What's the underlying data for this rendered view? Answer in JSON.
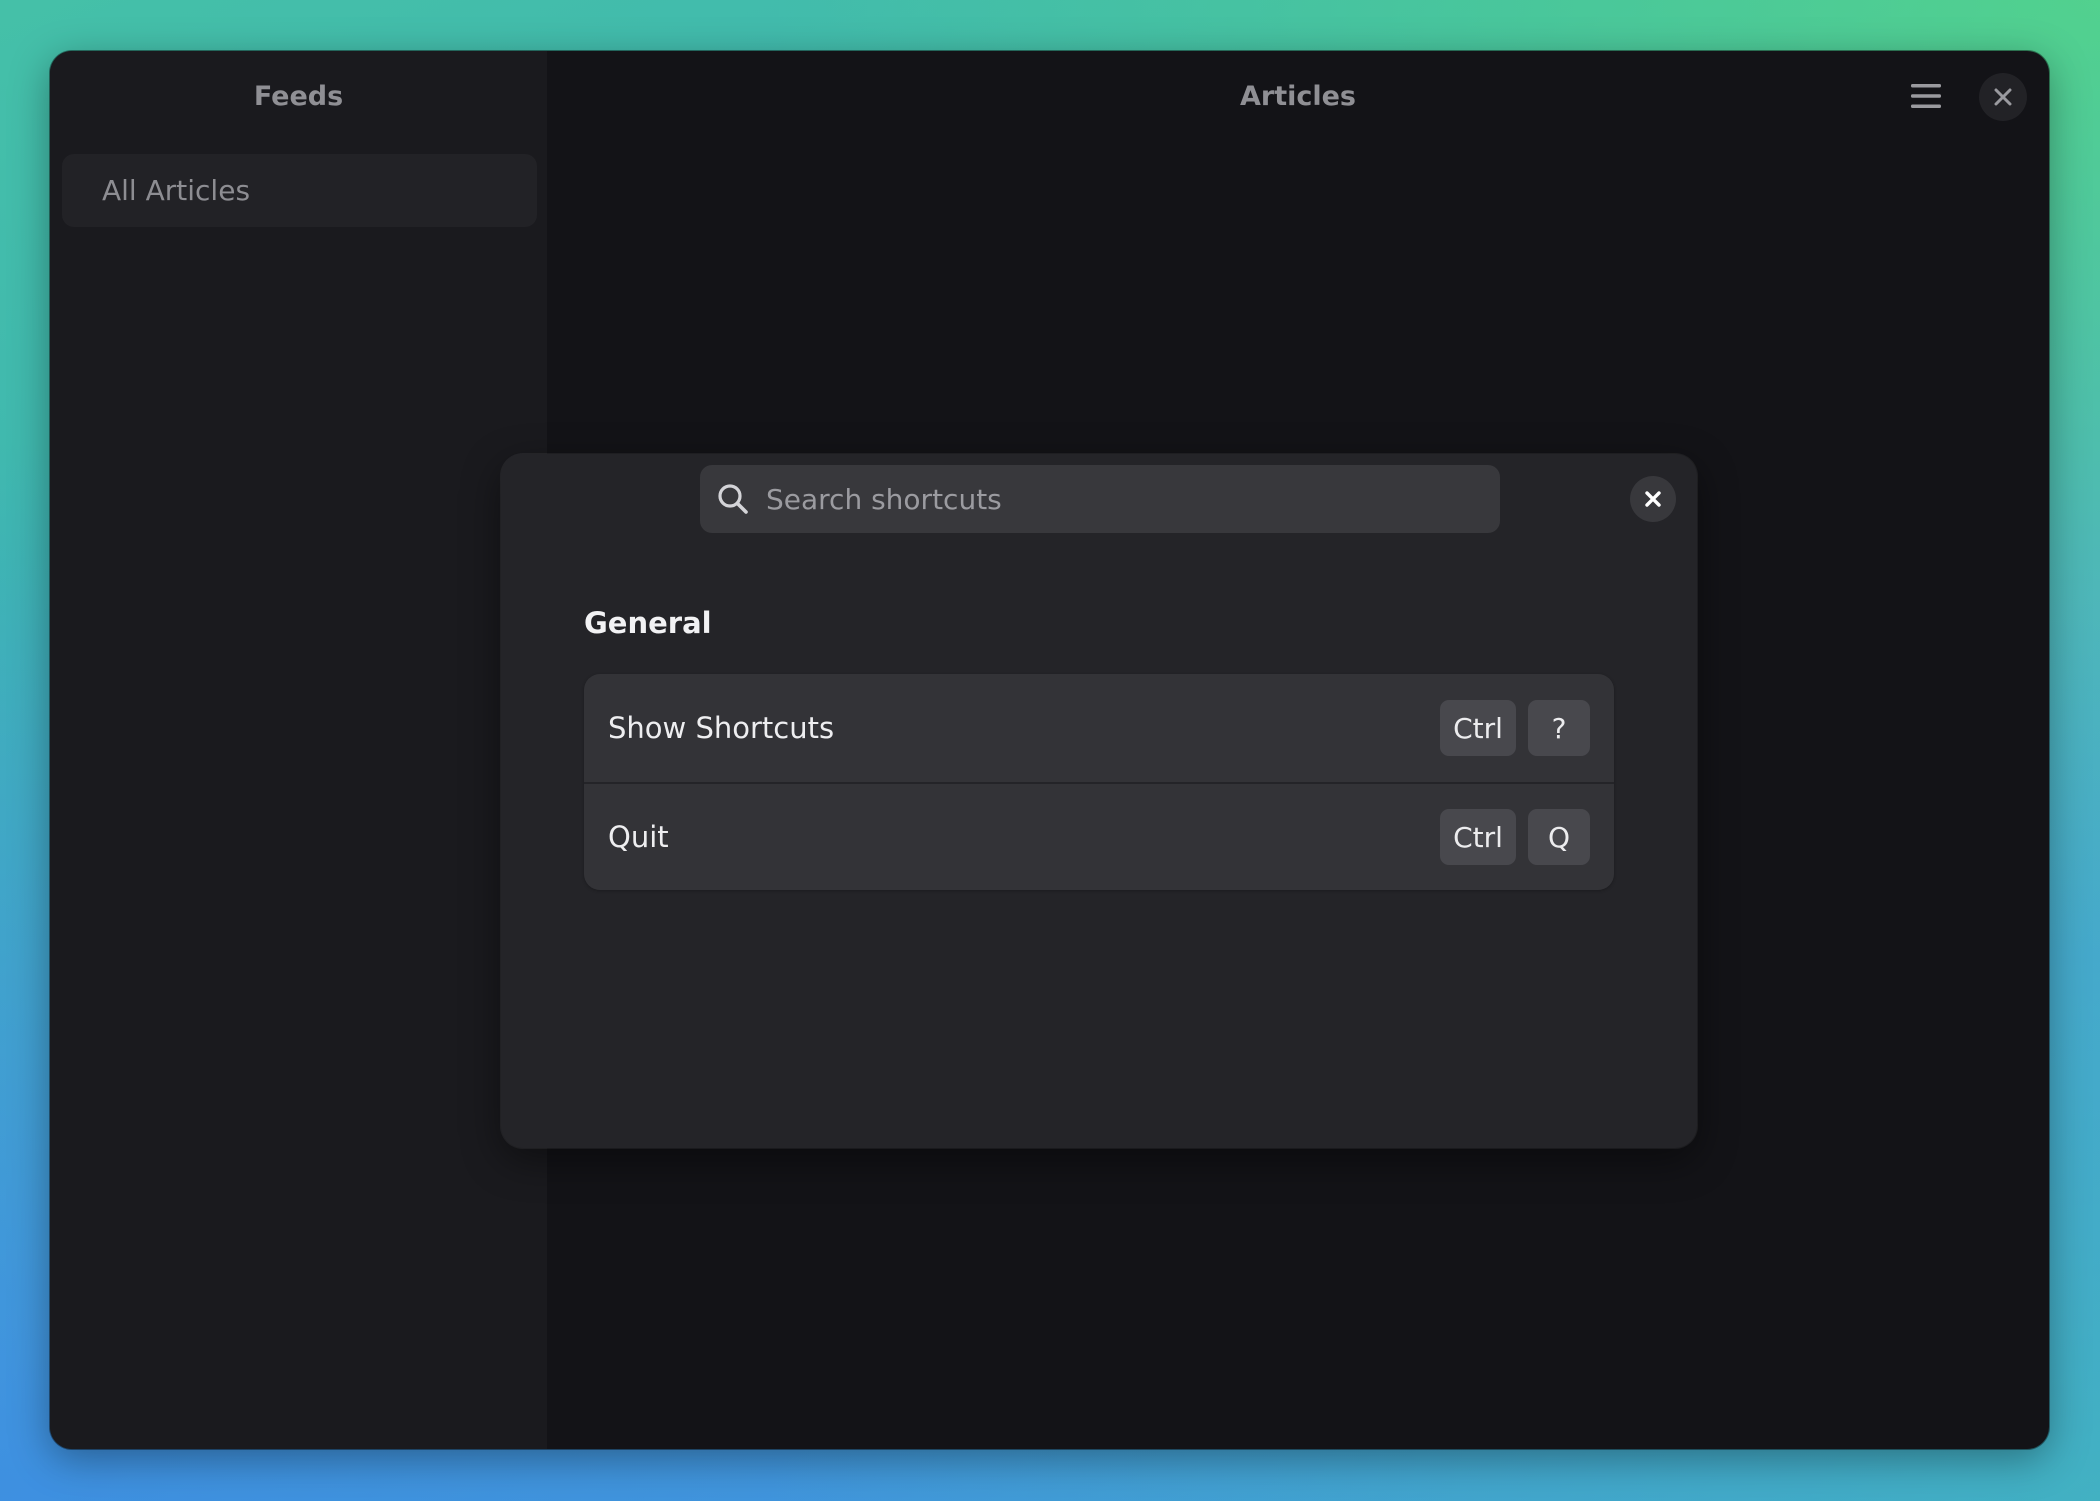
{
  "sidebar": {
    "title": "Feeds",
    "items": [
      {
        "label": "All Articles"
      }
    ]
  },
  "content": {
    "title": "Articles"
  },
  "window": {
    "menu_icon": "hamburger-menu-icon",
    "close_icon": "close-icon"
  },
  "dialog": {
    "search": {
      "placeholder": "Search shortcuts",
      "value": "",
      "icon": "search-icon"
    },
    "close_icon": "close-icon",
    "sections": [
      {
        "title": "General",
        "shortcuts": [
          {
            "label": "Show Shortcuts",
            "keys": [
              "Ctrl",
              "?"
            ]
          },
          {
            "label": "Quit",
            "keys": [
              "Ctrl",
              "Q"
            ]
          }
        ]
      }
    ]
  },
  "colors": {
    "window_bg": "#131317",
    "sidebar_bg": "#1a1a1e",
    "dialog_bg": "#242428",
    "row_bg": "#333337",
    "key_bg": "#48484d"
  }
}
